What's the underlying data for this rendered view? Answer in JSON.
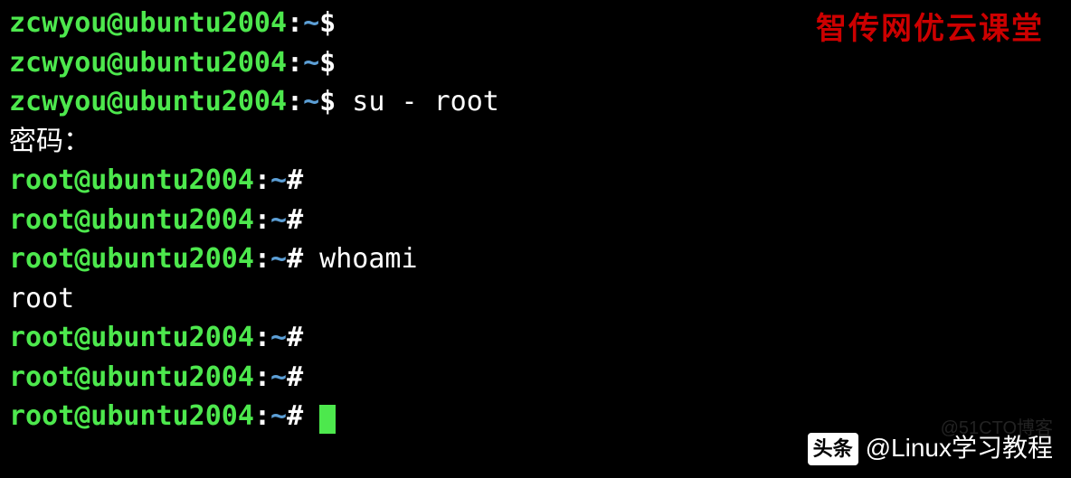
{
  "prompts": {
    "user": "zcwyou@ubuntu2004",
    "root": "root@ubuntu2004",
    "colon": ":",
    "tilde": "~",
    "user_symbol": "$",
    "root_symbol": "#"
  },
  "lines": {
    "l0_cmd": "",
    "l1_cmd": "",
    "l2_cmd": " su - root",
    "l3_output": "密码：",
    "l4_cmd": "",
    "l5_cmd": "",
    "l6_cmd": " whoami",
    "l7_output": "root",
    "l8_cmd": "",
    "l9_cmd": "",
    "l10_cmd": " "
  },
  "watermarks": {
    "top_right": "智传网优云课堂",
    "bottom_badge": "头条",
    "bottom_handle": "@Linux学习教程",
    "faded": "@51CTO博客"
  }
}
